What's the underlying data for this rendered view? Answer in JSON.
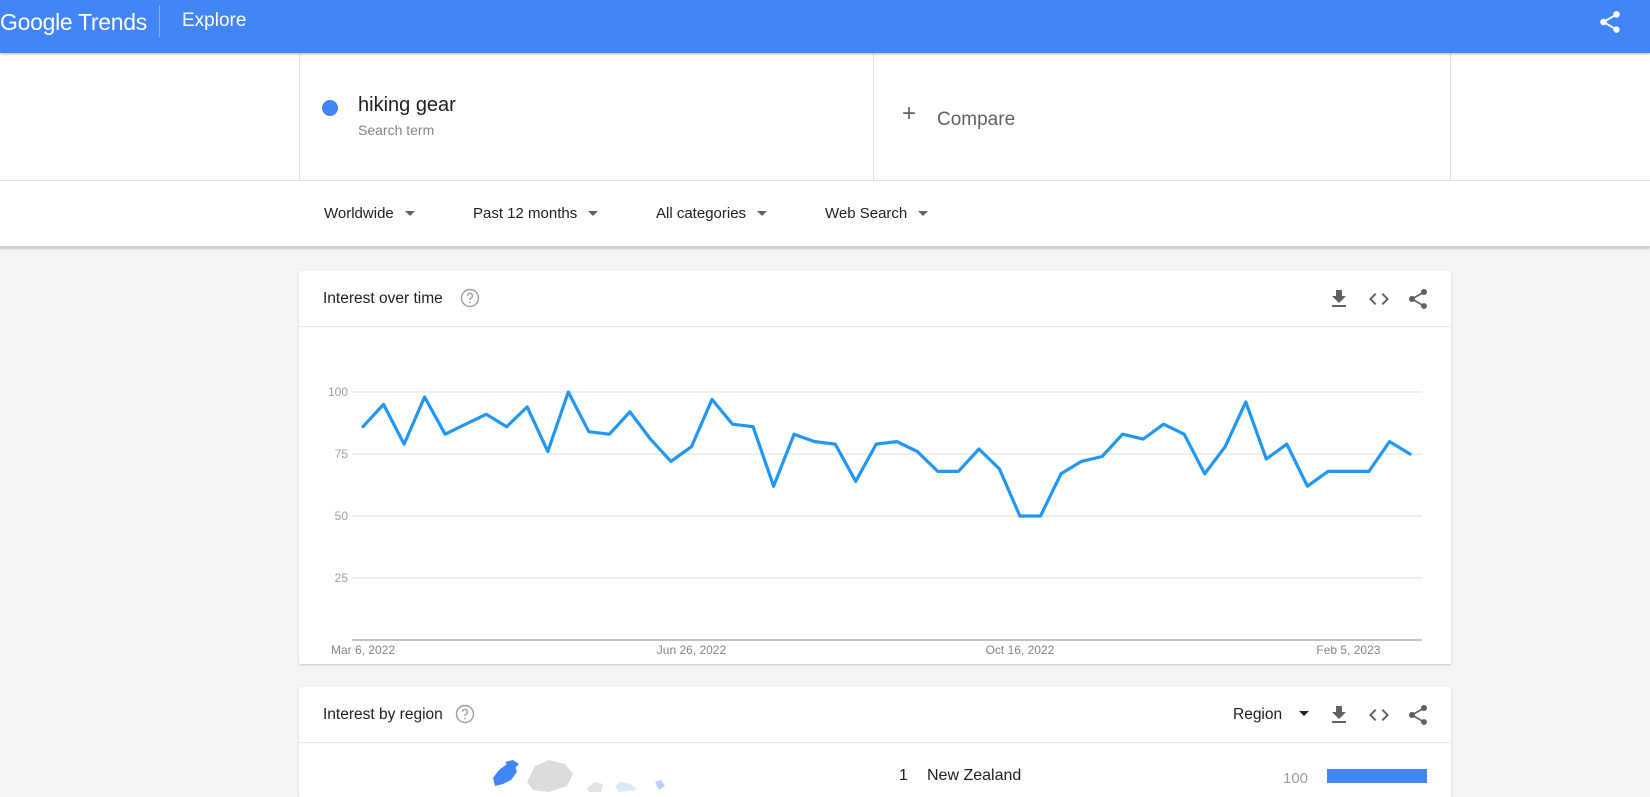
{
  "header": {
    "logo": "Google Trends",
    "section": "Explore"
  },
  "search": {
    "term": "hiking gear",
    "term_type": "Search term",
    "term_color": "#4285f4",
    "compare_icon": "+",
    "compare_label": "Compare"
  },
  "filters": [
    {
      "label": "Worldwide"
    },
    {
      "label": "Past 12 months"
    },
    {
      "label": "All categories"
    },
    {
      "label": "Web Search"
    }
  ],
  "interest_over_time": {
    "title": "Interest over time"
  },
  "interest_by_region": {
    "title": "Interest by region",
    "resolution": "Region",
    "rows": [
      {
        "rank": "1",
        "name": "New Zealand",
        "value": "100",
        "fraction": 1.0
      }
    ]
  },
  "colors": {
    "brand": "#4285f4",
    "line": "#2196f3"
  },
  "chart_data": {
    "type": "line",
    "title": "",
    "xlabel": "",
    "ylabel": "",
    "ylim": [
      0,
      100
    ],
    "yticks": [
      "25",
      "50",
      "75",
      "100"
    ],
    "xticks": [
      "Mar 6, 2022",
      "Jun 26, 2022",
      "Oct 16, 2022",
      "Feb 5, 2023"
    ],
    "grid": true,
    "x_start": "Mar 6, 2022",
    "x_step": "1 week",
    "series": [
      {
        "name": "hiking gear",
        "values": [
          86,
          95,
          79,
          98,
          83,
          87,
          91,
          86,
          94,
          76,
          100,
          84,
          83,
          92,
          81,
          72,
          78,
          97,
          87,
          86,
          62,
          83,
          80,
          79,
          64,
          79,
          80,
          76,
          68,
          68,
          77,
          69,
          50,
          50,
          67,
          72,
          74,
          83,
          81,
          87,
          83,
          67,
          78,
          96,
          73,
          79,
          62,
          68,
          68,
          68,
          80,
          75
        ]
      }
    ]
  }
}
